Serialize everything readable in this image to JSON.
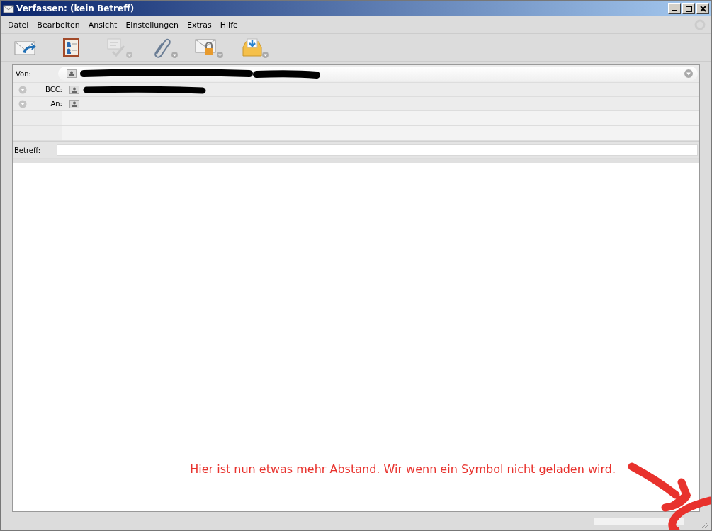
{
  "window": {
    "title": "Verfassen: (kein Betreff)"
  },
  "menu": [
    "Datei",
    "Bearbeiten",
    "Ansicht",
    "Einstellungen",
    "Extras",
    "Hilfe"
  ],
  "toolbar": [
    {
      "kind": "send",
      "disabled": false,
      "has_menu": false
    },
    {
      "kind": "contacts",
      "disabled": false,
      "has_menu": false
    },
    {
      "kind": "spelling",
      "disabled": true,
      "has_menu": true
    },
    {
      "kind": "attach",
      "disabled": false,
      "has_menu": true
    },
    {
      "kind": "security",
      "disabled": false,
      "has_menu": true
    },
    {
      "kind": "save",
      "disabled": false,
      "has_menu": true
    }
  ],
  "header": {
    "from_label": "Von:",
    "from_redacted": true,
    "recipients": [
      {
        "type_label": "BCC:",
        "redacted": true
      },
      {
        "type_label": "An:",
        "redacted": false
      }
    ],
    "subject_label": "Betreff:"
  },
  "annotation": {
    "text": "Hier ist nun etwas mehr Abstand. Wir wenn ein Symbol nicht geladen wird.",
    "color": "#e8322d"
  }
}
